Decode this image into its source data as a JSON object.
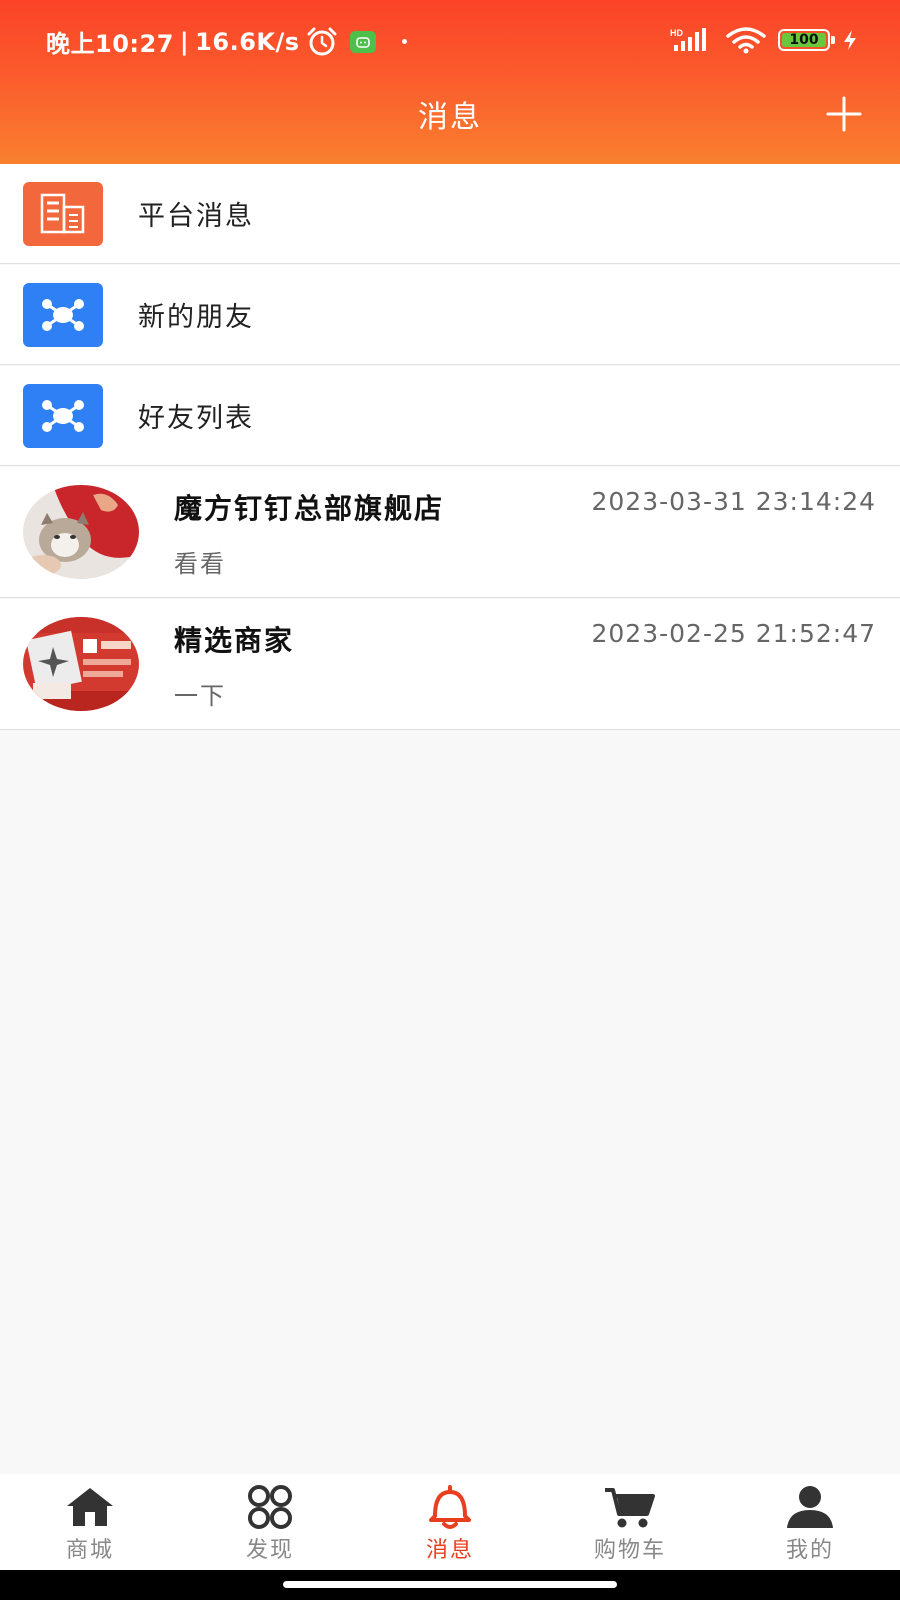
{
  "status_bar": {
    "time": "晚上10:27",
    "separator": "|",
    "speed": "16.6K/s",
    "battery": "100",
    "network_label": "HD"
  },
  "header": {
    "title": "消息",
    "add_icon": "plus-icon"
  },
  "menu": [
    {
      "label": "平台消息",
      "icon": "platform-message-icon",
      "color": "#f2673c"
    },
    {
      "label": "新的朋友",
      "icon": "network-icon",
      "color": "#2f7ff5"
    },
    {
      "label": "好友列表",
      "icon": "network-icon",
      "color": "#2f7ff5"
    }
  ],
  "chats": [
    {
      "name": "魔方钉钉总部旗舰店",
      "time": "2023-03-31 23:14:24",
      "message": "看看",
      "avatar": "cat-photo-avatar"
    },
    {
      "name": "精选商家",
      "time": "2023-02-25 21:52:47",
      "message": "一下",
      "avatar": "product-photo-avatar"
    }
  ],
  "bottom_nav": [
    {
      "label": "商城",
      "icon": "home-icon",
      "active": false
    },
    {
      "label": "发现",
      "icon": "discover-icon",
      "active": false
    },
    {
      "label": "消息",
      "icon": "bell-icon",
      "active": true
    },
    {
      "label": "购物车",
      "icon": "cart-icon",
      "active": false
    },
    {
      "label": "我的",
      "icon": "user-icon",
      "active": false
    }
  ],
  "colors": {
    "header_top": "#fb4328",
    "header_bottom": "#f9802f",
    "active_tab": "#e8401f",
    "inactive_tab": "#888888"
  }
}
